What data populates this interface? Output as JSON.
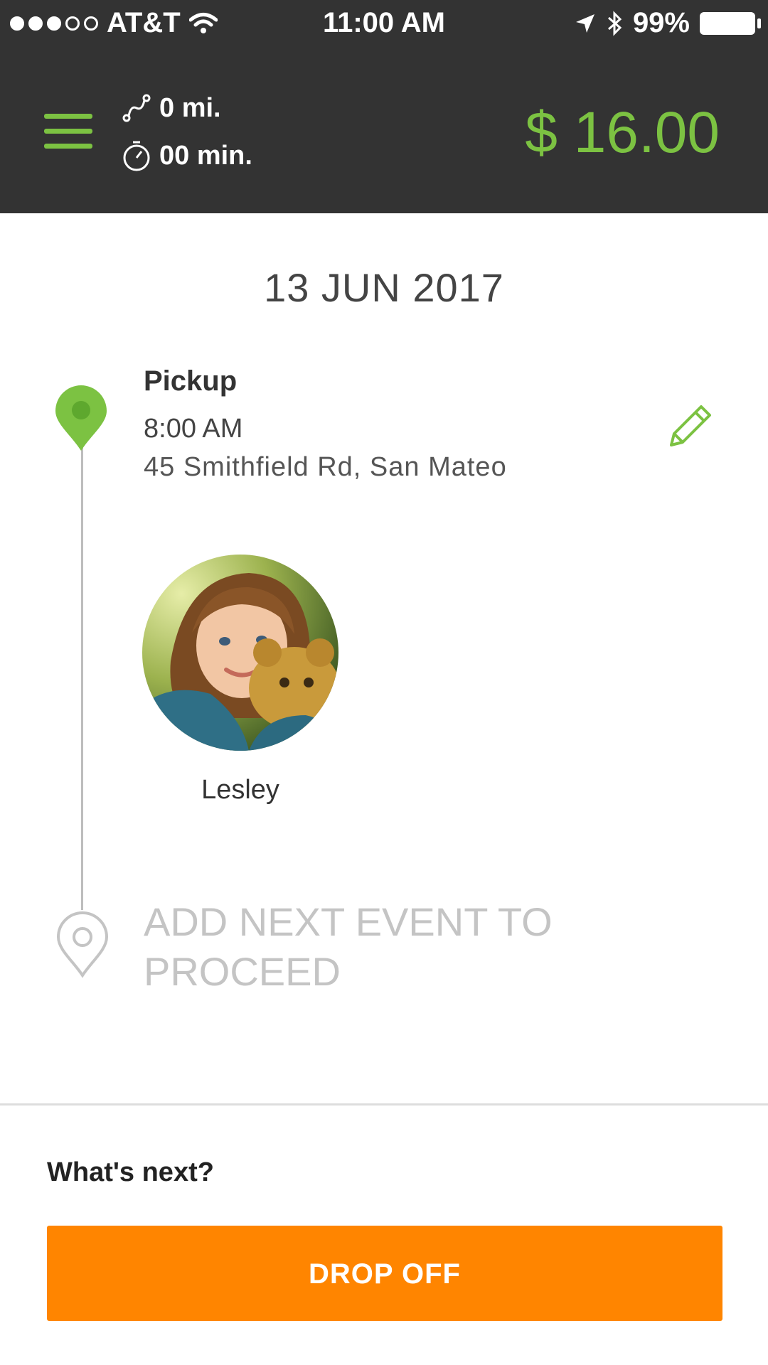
{
  "status_bar": {
    "carrier": "AT&T",
    "time": "11:00 AM",
    "battery": "99%",
    "signal_icon": "signal-dots-icon",
    "wifi_icon": "wifi-icon",
    "location_icon": "location-arrow-icon",
    "bluetooth_icon": "bluetooth-icon",
    "battery_icon": "battery-icon"
  },
  "header": {
    "menu_icon": "hamburger-menu-icon",
    "distance": "0 mi.",
    "distance_icon": "route-icon",
    "duration": "00 min.",
    "duration_icon": "stopwatch-icon",
    "price": "$ 16.00"
  },
  "trip": {
    "date": "13 JUN 2017",
    "pickup": {
      "title": "Pickup",
      "time": "8:00 AM",
      "address": "45 Smithfield Rd, San Mateo",
      "pin_icon": "map-pin-green-icon",
      "edit_icon": "pencil-icon"
    },
    "passenger": {
      "name": "Lesley"
    },
    "next_event": {
      "text_line1": "ADD NEXT EVENT TO",
      "text_line2": "PROCEED",
      "pin_icon": "map-pin-outline-icon"
    }
  },
  "footer": {
    "prompt": "What's next?",
    "button_label": "DROP OFF"
  },
  "colors": {
    "header_bg": "#333333",
    "accent_green": "#7cc242",
    "button_orange": "#ff8500"
  }
}
